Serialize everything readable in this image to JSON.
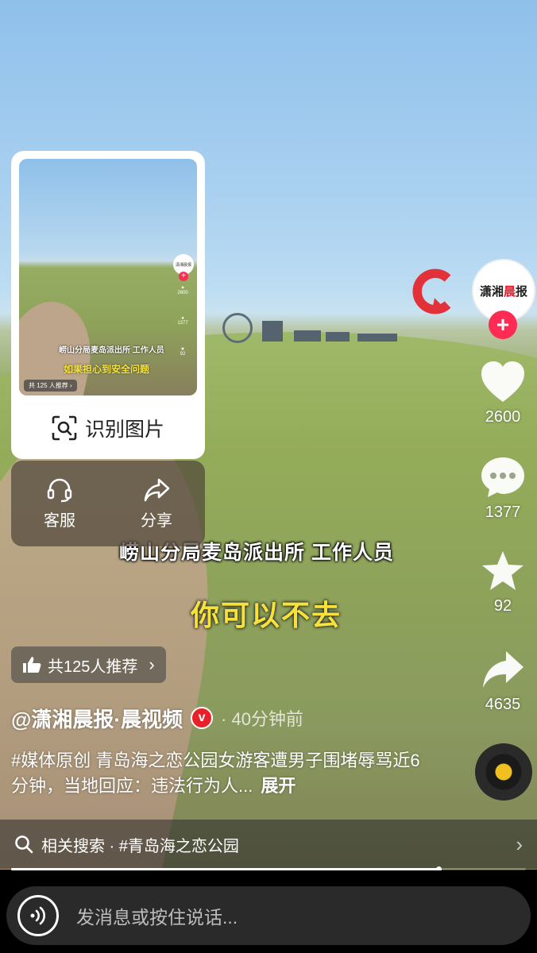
{
  "video": {
    "subtitle_line1": "崂山分局麦岛派出所 工作人员",
    "subtitle_line2": "你可以不去"
  },
  "actions": {
    "avatar_text_a": "潇湘",
    "avatar_text_b": "晨",
    "avatar_text_c": "报",
    "follow": "+",
    "likes": "2600",
    "comments": "1377",
    "favorites": "92",
    "shares": "4635"
  },
  "popup": {
    "thumb_subtitle1": "崂山分局麦岛派出所 工作人员",
    "thumb_subtitle2": "如果担心到安全问题",
    "thumb_badge": "共 125 人推荐 ›",
    "thumb_likes": "2600",
    "thumb_comments": "1377",
    "thumb_favs": "92",
    "recognize_label": "识别图片",
    "service_label": "客服",
    "share_label": "分享"
  },
  "info": {
    "recommend": "共125人推荐",
    "author": "@潇湘晨报·晨视频",
    "verified": "v",
    "time": "· 40分钟前",
    "description": "#媒体原创 青岛海之恋公园女游客遭男子围堵辱骂近6分钟，当地回应：违法行为人...",
    "expand": "展开"
  },
  "related": {
    "label": "相关搜索 · #青岛海之恋公园"
  },
  "progress": {
    "value": 0.83
  },
  "bottom": {
    "placeholder": "发消息或按住说话..."
  },
  "colors": {
    "accent": "#fe2c55",
    "subtitle_yellow": "#f6e23a",
    "verified_red": "#e8202a"
  }
}
